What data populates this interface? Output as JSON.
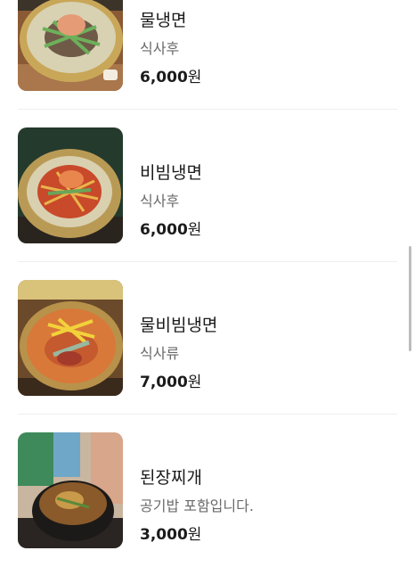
{
  "menu": {
    "items": [
      {
        "name": "물냉면",
        "desc": "식사후",
        "price": "6,000",
        "unit": "원"
      },
      {
        "name": "비빔냉면",
        "desc": "식사후",
        "price": "6,000",
        "unit": "원"
      },
      {
        "name": "물비빔냉면",
        "desc": "식사류",
        "price": "7,000",
        "unit": "원"
      },
      {
        "name": "된장찌개",
        "desc": "공기밥 포함입니다.",
        "price": "3,000",
        "unit": "원"
      }
    ]
  }
}
